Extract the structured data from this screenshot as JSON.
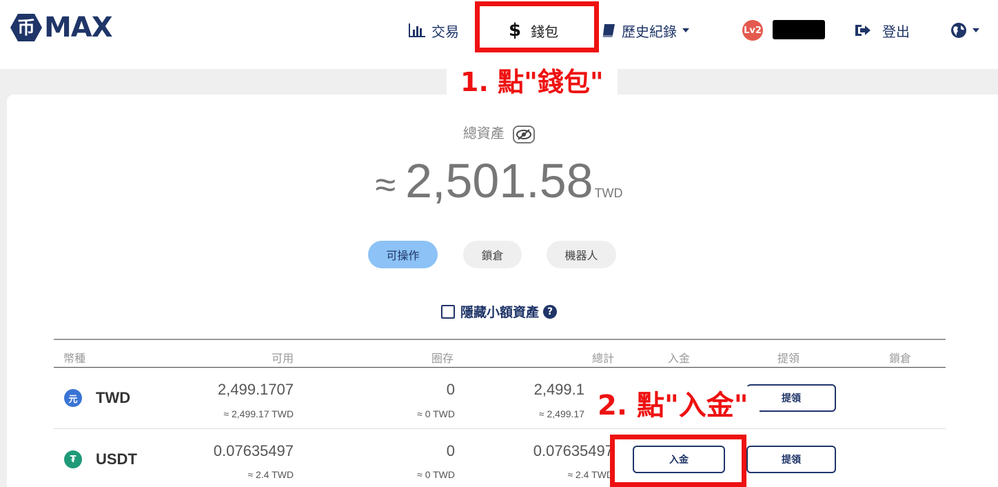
{
  "brand": {
    "name": "MAX",
    "logo_glyph": "币",
    "color": "#1f3568"
  },
  "nav": {
    "trade": {
      "icon": "bar-chart-icon",
      "label": "交易"
    },
    "wallet": {
      "icon": "dollar-icon",
      "symbol": "$",
      "label": "錢包"
    },
    "history": {
      "icon": "book-icon",
      "label": "歷史紀錄"
    },
    "user": {
      "level": "Lv2"
    },
    "logout": {
      "icon": "sign-out-icon",
      "label": "登出"
    },
    "language": {
      "icon": "globe-icon"
    }
  },
  "annotations": {
    "step1": "1. 點\"錢包\"",
    "step2": "2. 點\"入金\"",
    "highlight_color": "#ee1111"
  },
  "summary": {
    "label": "總資產",
    "approx": "≈",
    "value": "2,501.58",
    "unit": "TWD"
  },
  "tabs": [
    {
      "label": "可操作",
      "active": true
    },
    {
      "label": "鎖倉",
      "active": false
    },
    {
      "label": "機器人",
      "active": false
    }
  ],
  "filter": {
    "hide_small_label": "隱藏小額資產",
    "checked": false
  },
  "table": {
    "headers": [
      "幣種",
      "可用",
      "圈存",
      "總計",
      "入金",
      "提領",
      "鎖倉"
    ],
    "rows": [
      {
        "coin": "TWD",
        "icon_text": "元",
        "icon_color": "#3a74d4",
        "available": "2,499.1707",
        "available_twd": "≈ 2,499.17 TWD",
        "locked": "0",
        "locked_twd": "≈ 0 TWD",
        "total": "2,499.1",
        "total_twd": "≈ 2,499.17",
        "withdraw_label": "提領"
      },
      {
        "coin": "USDT",
        "icon_text": "₮",
        "icon_color": "#1f9a79",
        "available": "0.07635497",
        "available_twd": "≈ 2.4 TWD",
        "locked": "0",
        "locked_twd": "≈ 0 TWD",
        "total": "0.07635497",
        "total_twd": "≈ 2.4 TWD",
        "deposit_label": "入金",
        "withdraw_label": "提領"
      }
    ]
  }
}
